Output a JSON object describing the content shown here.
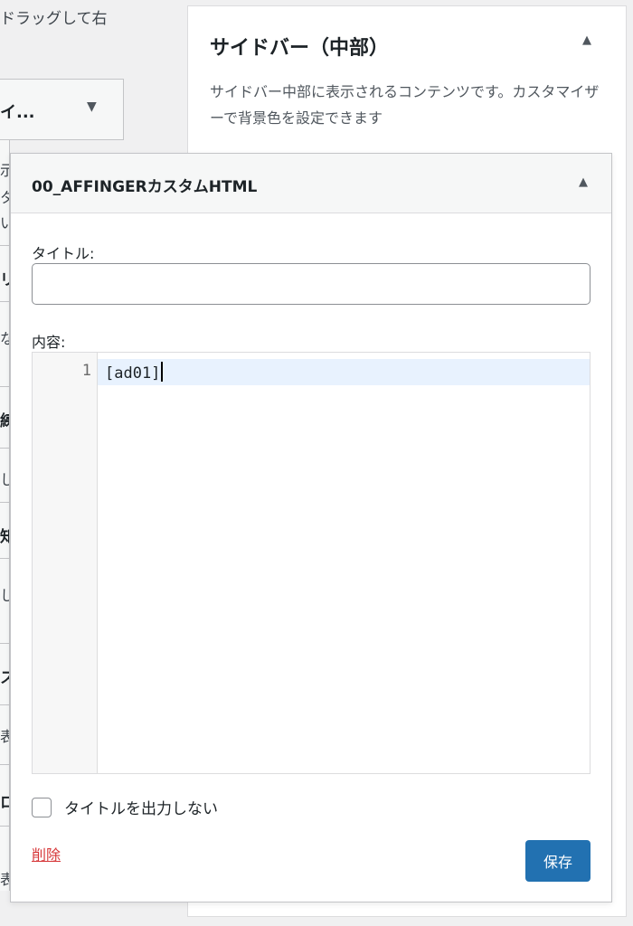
{
  "background": {
    "help_text": "ドラッグして右",
    "widget_title": "イ...",
    "fragments": [
      "示",
      "タ",
      "い",
      "リ",
      "な",
      "練",
      "し",
      "知",
      "し",
      "ス",
      "表",
      "ロ",
      "表"
    ]
  },
  "sidebar": {
    "title": "サイドバー（中部）",
    "description": "サイドバー中部に表示されるコンテンツです。カスタマイザーで背景色を設定できます"
  },
  "widget": {
    "name": "00_AFFINGERカスタムHTML",
    "title_label": "タイトル:",
    "title_value": "",
    "content_label": "内容:",
    "line_number": "1",
    "code": "[ad01]",
    "checkbox_label": "タイトルを出力しない",
    "delete_label": "削除",
    "save_label": "保存"
  },
  "icons": {
    "collapse": "triangle-up-icon",
    "expand": "triangle-down-icon"
  },
  "colors": {
    "primary": "#2271b1",
    "danger": "#d63638",
    "active_line": "#e8f2fe"
  }
}
